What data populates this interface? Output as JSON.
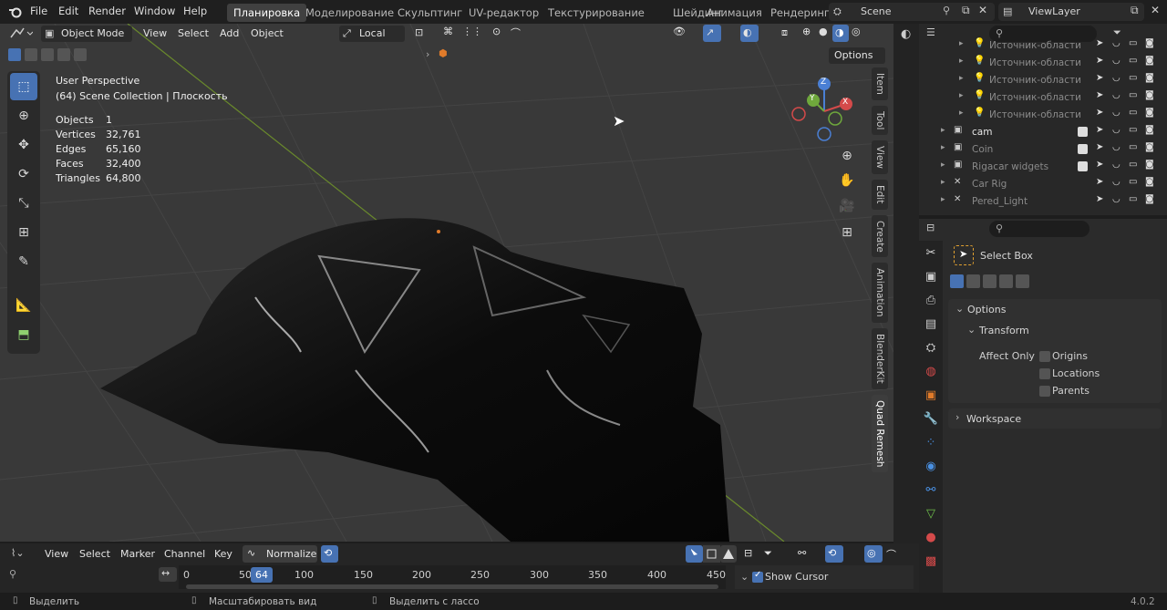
{
  "topbar": {
    "menus": [
      "File",
      "Edit",
      "Render",
      "Window",
      "Help"
    ],
    "workspaces": [
      "Планировка",
      "Моделирование",
      "Скульптинг",
      "UV-редактор",
      "Текстурирование",
      "Шейдинг",
      "Анимация",
      "Рендеринг"
    ],
    "active_workspace": "Планировка",
    "scene": "Scene",
    "view_layer": "ViewLayer"
  },
  "viewport_header": {
    "mode": "Object Mode",
    "menus": [
      "View",
      "Select",
      "Add",
      "Object"
    ],
    "orientation": "Local",
    "options": "Options"
  },
  "viewport_info": {
    "perspective": "User Perspective",
    "collection": "(64) Scene Collection | Плоскость",
    "stats": [
      {
        "label": "Objects",
        "value": "1"
      },
      {
        "label": "Vertices",
        "value": "32,761"
      },
      {
        "label": "Edges",
        "value": "65,160"
      },
      {
        "label": "Faces",
        "value": "32,400"
      },
      {
        "label": "Triangles",
        "value": "64,800"
      }
    ]
  },
  "side_tabs": [
    "Item",
    "Tool",
    "View",
    "Edit",
    "Create",
    "Animation",
    "BlenderKit",
    "Quad Remesh"
  ],
  "active_side_tab": "Quad Remesh",
  "gizmo": {
    "x": "X",
    "y": "Y",
    "z": "Z"
  },
  "outliner": {
    "items": [
      {
        "name": "Источник-области",
        "dim": true
      },
      {
        "name": "Источник-области",
        "dim": true
      },
      {
        "name": "Источник-области",
        "dim": true
      },
      {
        "name": "Источник-области",
        "dim": true
      },
      {
        "name": "Источник-области",
        "dim": true
      },
      {
        "name": "cam",
        "dim": false
      },
      {
        "name": "Coin",
        "dim": true
      },
      {
        "name": "Rigacar widgets",
        "dim": true
      },
      {
        "name": "Car Rig",
        "dim": true
      },
      {
        "name": "Pered_Light",
        "dim": true
      }
    ]
  },
  "properties": {
    "tool_name": "Select Box",
    "panel_options": "Options",
    "panel_transform": "Transform",
    "affect_only": "Affect Only",
    "checkboxes": [
      "Origins",
      "Locations",
      "Parents"
    ],
    "panel_workspace": "Workspace"
  },
  "timeline": {
    "menus": [
      "View",
      "Select",
      "Marker",
      "Channel",
      "Key"
    ],
    "normalize": "Normalize",
    "frames": [
      "0",
      "50",
      "100",
      "150",
      "200",
      "250",
      "300",
      "350",
      "400",
      "450"
    ],
    "current_frame": "64",
    "show_cursor": "Show Cursor"
  },
  "statusbar": {
    "select": "Выделить",
    "zoom": "Масштабировать вид",
    "lasso": "Выделить с лассо",
    "version": "4.0.2"
  },
  "colors": {
    "accent": "#4772b3",
    "orange": "#e07b2a"
  }
}
